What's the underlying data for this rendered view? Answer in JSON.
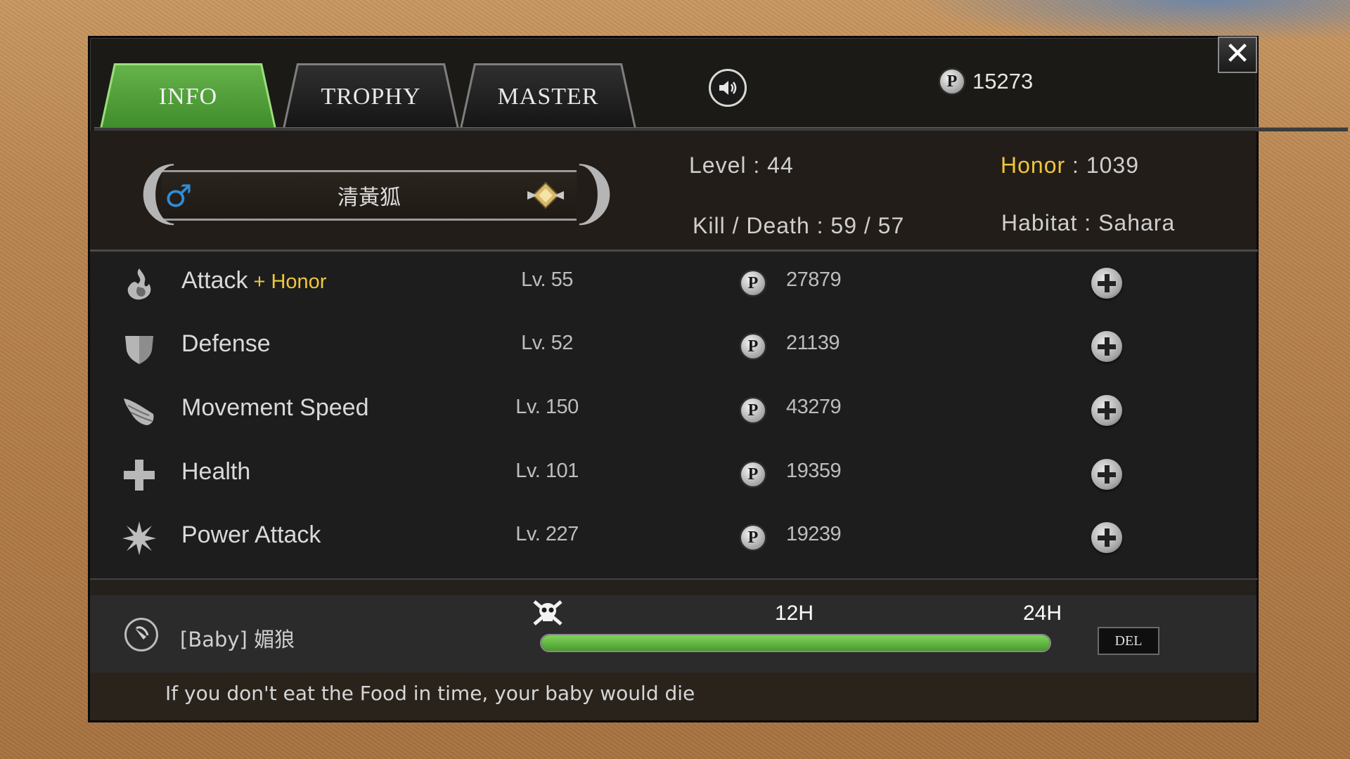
{
  "tabs": [
    {
      "label": "INFO",
      "active": true
    },
    {
      "label": "TROPHY",
      "active": false
    },
    {
      "label": "MASTER",
      "active": false
    }
  ],
  "header": {
    "sound_icon": "speaker-icon",
    "points_icon": "P",
    "points": "15273",
    "close_icon": "✕"
  },
  "profile": {
    "gender_icon": "♂",
    "name": "清黃狐",
    "level_key": "Level",
    "level_value": "44",
    "kd_key": "Kill / Death",
    "kd_value": "59 / 57",
    "honor_key": "Honor",
    "honor_value": "1039",
    "habitat_key": "Habitat",
    "habitat_value": "Sahara",
    "separator": ":"
  },
  "stats": [
    {
      "name": "Attack",
      "extra": "+ Honor",
      "level": "Lv. 55",
      "cost": "27879",
      "icon": "flame-icon"
    },
    {
      "name": "Defense",
      "extra": "",
      "level": "Lv. 52",
      "cost": "21139",
      "icon": "shield-icon"
    },
    {
      "name": "Movement Speed",
      "extra": "",
      "level": "Lv. 150",
      "cost": "43279",
      "icon": "wing-icon"
    },
    {
      "name": "Health",
      "extra": "",
      "level": "Lv. 101",
      "cost": "19359",
      "icon": "cross-icon"
    },
    {
      "name": "Power Attack",
      "extra": "",
      "level": "Lv. 227",
      "cost": "19239",
      "icon": "burst-icon"
    }
  ],
  "pet": {
    "name": "[Baby]  媚狼",
    "timer_mid": "12H",
    "timer_end": "24H",
    "timer_fill": 1.0,
    "del_label": "DEL",
    "warning": "If you don't eat the Food in time, your baby would die"
  },
  "colors": {
    "tab_active": "#4f9e37",
    "honor_gold": "#f0c63a",
    "gender_blue": "#2f8dd6",
    "bar_green": "#5fb33f"
  }
}
